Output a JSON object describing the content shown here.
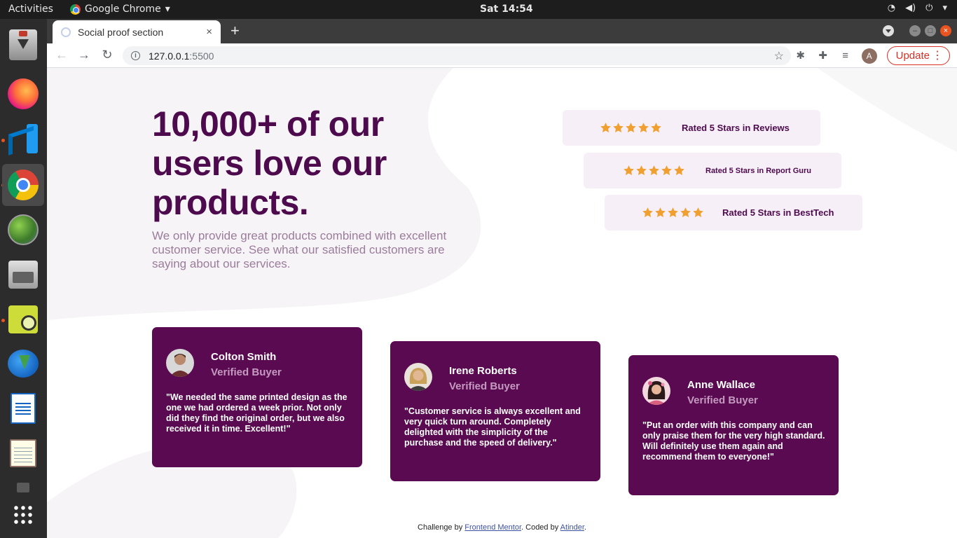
{
  "topbar": {
    "activities": "Activities",
    "app_name": "Google Chrome",
    "app_menu_icon": "chevron-down-icon",
    "clock": "Sat 14:54"
  },
  "browser": {
    "tab_title": "Social proof section",
    "tab_close": "×",
    "new_tab": "+",
    "url_host": "127.0.0.1",
    "url_port": ":5500",
    "avatar_letter": "A",
    "update_label": "Update"
  },
  "page": {
    "colors": {
      "primary": "#4d0a4d",
      "card_bg": "#5a0a50",
      "rating_bg": "#f7eff7",
      "star": "#f0a030",
      "muted_text": "#9b7c9b",
      "verified": "#c49ac0"
    },
    "hero": {
      "title": "10,000+ of our users love our products.",
      "text": "We only provide great products combined with excellent customer service. See what our satisfied customers are saying about our services."
    },
    "ratings": [
      {
        "stars": 5,
        "label": "Rated 5 Stars in Reviews"
      },
      {
        "stars": 5,
        "label": "Rated 5 Stars in Report Guru"
      },
      {
        "stars": 5,
        "label": "Rated 5 Stars in BestTech"
      }
    ],
    "testimonials": [
      {
        "name": "Colton Smith",
        "status": "Verified Buyer",
        "quote": "\"We needed the same printed design as the one we had ordered a week prior. Not only did they find the original order, but we also received it in time. Excellent!\""
      },
      {
        "name": "Irene Roberts",
        "status": "Verified Buyer",
        "quote": "\"Customer service is always excellent and very quick turn around. Completely delighted with the simplicity of the purchase and the speed of delivery.\""
      },
      {
        "name": "Anne Wallace",
        "status": "Verified Buyer",
        "quote": "\"Put an order with this company and can only praise them for the very high standard. Will definitely use them again and recommend them to everyone!\""
      }
    ],
    "attribution": {
      "prefix": "Challenge by ",
      "link1": "Frontend Mentor",
      "middle": ". Coded by ",
      "link2": "Atinder",
      "suffix": "."
    }
  }
}
